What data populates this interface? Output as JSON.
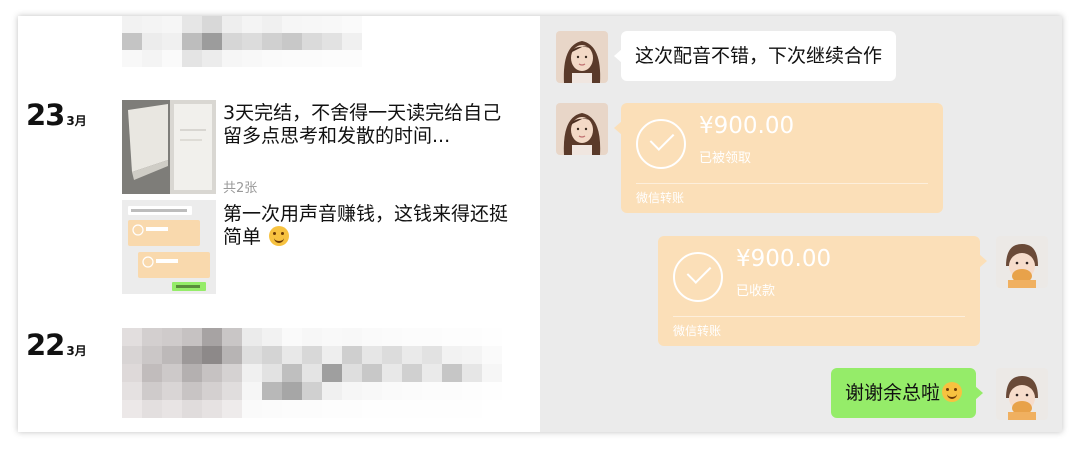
{
  "moments": {
    "posts": [
      {
        "day": "23",
        "month": "3月",
        "entries": [
          {
            "text": "3天完结，不舍得一天读完给自己留多点思考和发散的时间...",
            "count": "共2张"
          },
          {
            "text": "第一次用声音赚钱，这钱来得还挺简单"
          }
        ]
      },
      {
        "day": "22",
        "month": "3月"
      }
    ]
  },
  "chat": {
    "messages": [
      {
        "type": "text",
        "side": "left",
        "text": "这次配音不错，下次继续合作"
      },
      {
        "type": "transfer",
        "side": "left",
        "amount": "¥900.00",
        "status": "已被领取",
        "kind": "微信转账"
      },
      {
        "type": "transfer",
        "side": "right",
        "amount": "¥900.00",
        "status": "已收款",
        "kind": "微信转账"
      },
      {
        "type": "text",
        "side": "right",
        "text": "谢谢余总啦"
      }
    ]
  },
  "colors": {
    "transfer_bg": "#fbdfb8",
    "sent_bubble": "#95ec69",
    "chat_bg": "#ebebeb"
  }
}
